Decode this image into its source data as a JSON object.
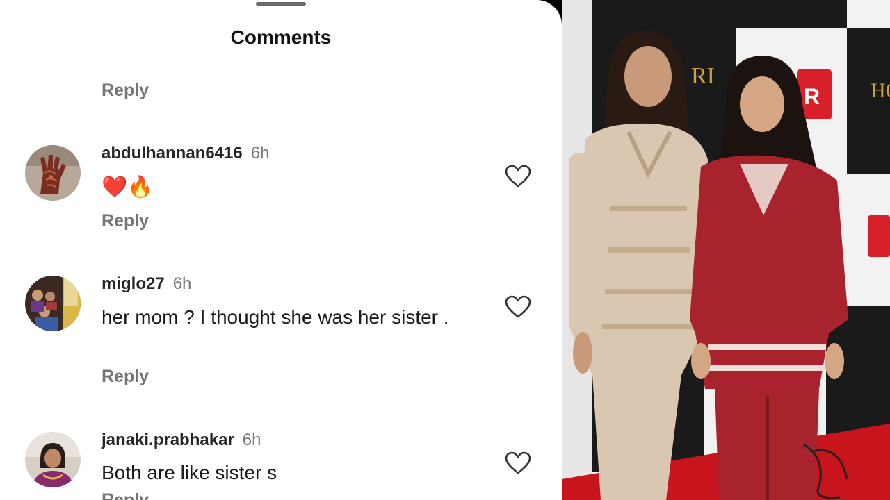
{
  "sheet": {
    "title": "Comments"
  },
  "comments": [
    {
      "reply_label": "Reply"
    },
    {
      "username": "abdulhannan6416",
      "time": "6h",
      "text": "❤️🔥",
      "reply_label": "Reply",
      "avatar_icon": "henna-hand-avatar",
      "like_icon": "heart-outline-icon"
    },
    {
      "username": "miglo27",
      "time": "6h",
      "text": "her mom ? I thought she was her sister .",
      "reply_label": "Reply",
      "avatar_icon": "group-photo-avatar",
      "like_icon": "heart-outline-icon"
    },
    {
      "username": "janaki.prabhakar",
      "time": "6h",
      "text": "Both are like sister s",
      "reply_label": "Reply",
      "avatar_icon": "woman-portrait-avatar",
      "like_icon": "heart-outline-icon"
    }
  ],
  "photo": {
    "backdrop_text": [
      "RI",
      "HO",
      "R"
    ],
    "colors": {
      "backdrop_dark": "#1a1a1a",
      "backdrop_light": "#f2f2f2",
      "carpet": "#c8141c",
      "kurta_beige": "#d9c7b2",
      "kurta_red": "#a8232d"
    }
  }
}
